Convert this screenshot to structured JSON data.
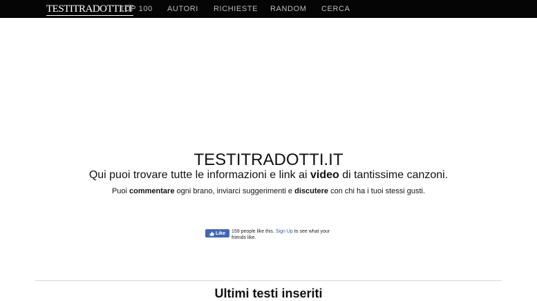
{
  "navbar": {
    "logo_text": "TESTITRADOTTI.IT",
    "items": [
      {
        "label": "TOP 100"
      },
      {
        "label": "AUTORI"
      },
      {
        "label": "RICHIESTE"
      },
      {
        "label": "RANDOM"
      },
      {
        "label": "CERCA"
      }
    ]
  },
  "hero": {
    "title": "TESTITRADOTTI.IT",
    "subtitle_part1": "Qui puoi trovare tutte le informazioni e link ai ",
    "subtitle_bold": "video",
    "subtitle_part2": " di tantissime canzoni.",
    "note_part1": "Puoi ",
    "note_bold1": "commentare",
    "note_part2": " ogni brano, inviarci suggerimenti e ",
    "note_bold2": "discutere",
    "note_part3": " con chi ha i tuoi stessi gusti."
  },
  "facebook": {
    "like_label": "Like",
    "count_text": "159 people like this.",
    "signup_label": "Sign Up",
    "after_signup": " to see what your friends like.",
    "button_color": "#4267b2"
  },
  "section": {
    "heading": "Ultimi testi inseriti"
  }
}
